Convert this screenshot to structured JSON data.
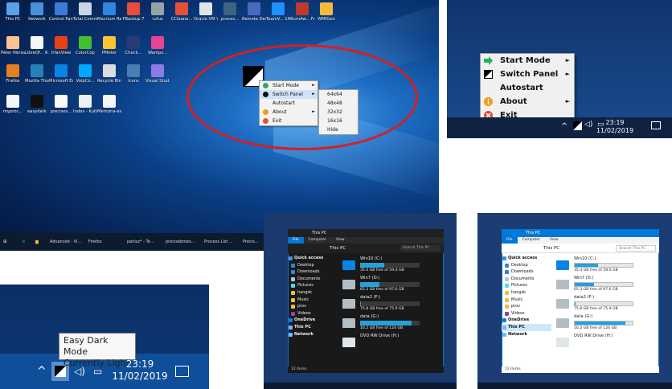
{
  "desktop": {
    "icons": [
      {
        "label": "This PC",
        "color": "#5aa0e8"
      },
      {
        "label": "Network",
        "color": "#4a90d9"
      },
      {
        "label": "Control Panel",
        "color": "#3a7bd5"
      },
      {
        "label": "Total Comma...",
        "color": "#c8d6e5"
      },
      {
        "label": "Macrium Reflect",
        "color": "#2e86de"
      },
      {
        "label": "FBackup 7",
        "color": "#e74c3c"
      },
      {
        "label": "rufus",
        "color": "#95a5a6"
      },
      {
        "label": "CCleane...",
        "color": "#e55039"
      },
      {
        "label": "Oracle VM Virt...",
        "color": "#dfe6e9"
      },
      {
        "label": "proces...",
        "color": "#3c6382"
      },
      {
        "label": "Remote Desktop...",
        "color": "#4a69bd"
      },
      {
        "label": "TeamV... 14",
        "color": "#1e90ff"
      },
      {
        "label": "BurnAw... Free",
        "color": "#c0392b"
      },
      {
        "label": "WMIGen",
        "color": "#f6b93b"
      },
      {
        "label": "Péter Pánisz",
        "color": "#f8c291"
      },
      {
        "label": "LibreOf... 6.2",
        "color": "#f5f6fa"
      },
      {
        "label": "IrfanView",
        "color": "#e84118"
      },
      {
        "label": "ColorCop",
        "color": "#44bd32"
      },
      {
        "label": "PMeter",
        "color": "#fbc531"
      },
      {
        "label": "Check...",
        "color": "#273c75"
      },
      {
        "label": "Wamps...",
        "color": "#e84393"
      },
      {
        "label": "Firefox",
        "color": "#e67e22"
      },
      {
        "label": "Mozilla Thunde...",
        "color": "#2980b9"
      },
      {
        "label": "Microsoft Edge",
        "color": "#0984e3"
      },
      {
        "label": "VoipCo...",
        "color": "#00a8ff"
      },
      {
        "label": "Recycle Bin",
        "color": "#dcdde1"
      },
      {
        "label": "Icons",
        "color": "#487eb0"
      },
      {
        "label": "Visual Stud...",
        "color": "#8c7ae6"
      },
      {
        "label": "myproc...",
        "color": "#f5f6fa"
      },
      {
        "label": "easydark",
        "color": "#111111"
      },
      {
        "label": "precises...",
        "color": "#fafafa"
      },
      {
        "label": "Index - Kultúr -...",
        "color": "#ecf0f1"
      },
      {
        "label": "Memória-és objek...",
        "color": "#f5f5f5"
      }
    ],
    "menu": {
      "items": [
        {
          "label": "Start Mode",
          "glyph": "#27ae60",
          "arrow": "►"
        },
        {
          "label": "Switch Panel",
          "glyph": "#111111",
          "arrow": "►"
        },
        {
          "label": "Autostart",
          "glyph": "",
          "arrow": ""
        },
        {
          "label": "About",
          "glyph": "#f39c12",
          "arrow": "►"
        },
        {
          "label": "Exit",
          "glyph": "#e74c3c",
          "arrow": ""
        }
      ],
      "submenu": [
        "64x64",
        "48x48",
        "32x32",
        "16x16",
        "Hide"
      ]
    },
    "taskbar": [
      "Advanced - Vi...",
      "Firefox",
      "panisz* - Te...",
      "precisebmes...",
      "Process List ...",
      "Precis..."
    ]
  },
  "tray_menu": {
    "items": [
      {
        "label": "Start Mode",
        "arrow": "►"
      },
      {
        "label": "Switch Panel",
        "arrow": "►"
      },
      {
        "label": "Autostart",
        "arrow": ""
      },
      {
        "label": "About",
        "arrow": "►"
      },
      {
        "label": "Exit",
        "arrow": ""
      }
    ],
    "time": "23:19",
    "date": "11/02/2019",
    "tray_glyphs": {
      "chevron": "^",
      "volume": "🕪"
    }
  },
  "tooltip": {
    "line1": "Easy Dark Mode",
    "line2": "Currently Light",
    "time": "23:19",
    "date": "11/02/2019"
  },
  "explorer": {
    "title": "This PC",
    "tabs": [
      "File",
      "Computer",
      "View"
    ],
    "address": "This PC",
    "search_placeholder": "Search This PC",
    "nav": [
      {
        "label": "Quick access",
        "level": "top",
        "color": "#4a90d9"
      },
      {
        "label": "Desktop",
        "level": "sub",
        "color": "#2e86de"
      },
      {
        "label": "Downloads",
        "level": "sub",
        "color": "#2e86de"
      },
      {
        "label": "Documents",
        "level": "sub",
        "color": "#bdc3c7"
      },
      {
        "label": "Pictures",
        "level": "sub",
        "color": "#48dbfb"
      },
      {
        "label": "hangsk",
        "level": "sub",
        "color": "#f6b93b"
      },
      {
        "label": "Music",
        "level": "sub",
        "color": "#f6b93b"
      },
      {
        "label": "prov",
        "level": "sub",
        "color": "#f6b93b"
      },
      {
        "label": "Videos",
        "level": "sub",
        "color": "#8e44ad"
      },
      {
        "label": "OneDrive",
        "level": "top",
        "color": "#0984e3"
      },
      {
        "label": "This PC",
        "level": "top",
        "color": "#74b9ff"
      },
      {
        "label": "Network",
        "level": "top",
        "color": "#74b9ff"
      }
    ],
    "drives": [
      {
        "name": "Win10 (C:)",
        "free": "35.4 GB free of 59.0 GB",
        "used_fraction": 0.4,
        "icon_color": "#0984e3"
      },
      {
        "name": "Win7 (D:)",
        "free": "65.3 GB free of 97.6 GB",
        "used_fraction": 0.33,
        "icon_color": "#b2bec3"
      },
      {
        "name": "data2 (F:)",
        "free": "75.8 GB free of 75.9 GB",
        "used_fraction": 0.01,
        "icon_color": "#b2bec3"
      },
      {
        "name": "data (G:)",
        "free": "16.2 GB free of 124 GB",
        "used_fraction": 0.87,
        "icon_color": "#b2bec3"
      },
      {
        "name": "DVD RW Drive (H:)",
        "free": "",
        "used_fraction": 0,
        "icon_color": "#dfe6e9"
      }
    ],
    "status": "12 items"
  }
}
